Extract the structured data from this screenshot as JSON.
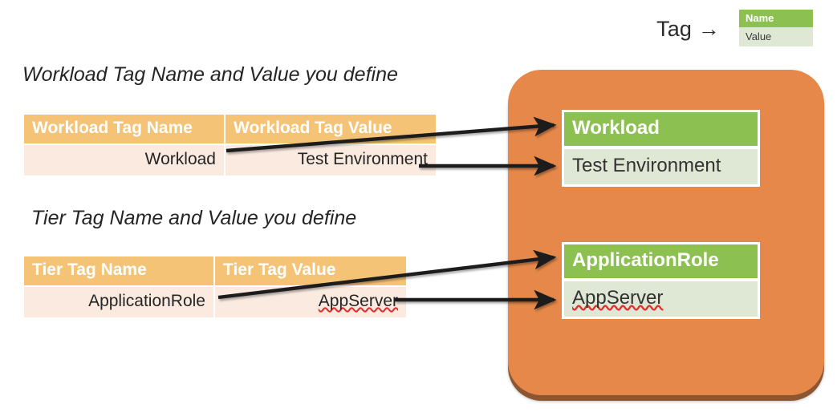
{
  "legend": {
    "label": "Tag →",
    "name_cell": "Name",
    "value_cell": "Value",
    "name_color": "#8cc152",
    "value_color": "#dfe8d4"
  },
  "sections": [
    {
      "heading": "Workload Tag Name and Value you define",
      "table": {
        "headers": [
          "Workload Tag Name",
          "Workload Tag Value"
        ],
        "rows": [
          [
            "Workload",
            "Test Environment"
          ]
        ]
      },
      "card": {
        "name": "Workload",
        "value": "Test Environment"
      }
    },
    {
      "heading": "Tier Tag Name and Value you define",
      "table": {
        "headers": [
          "Tier Tag Name",
          "Tier Tag Value"
        ],
        "rows": [
          [
            "ApplicationRole",
            "AppServer"
          ]
        ]
      },
      "card": {
        "name": "ApplicationRole",
        "value": "AppServer"
      }
    }
  ],
  "container": {
    "fill_color": "#e5884a",
    "shadow_color": "#8e5630"
  },
  "arrows": {
    "color": "#1a1a1a",
    "count": 4
  }
}
